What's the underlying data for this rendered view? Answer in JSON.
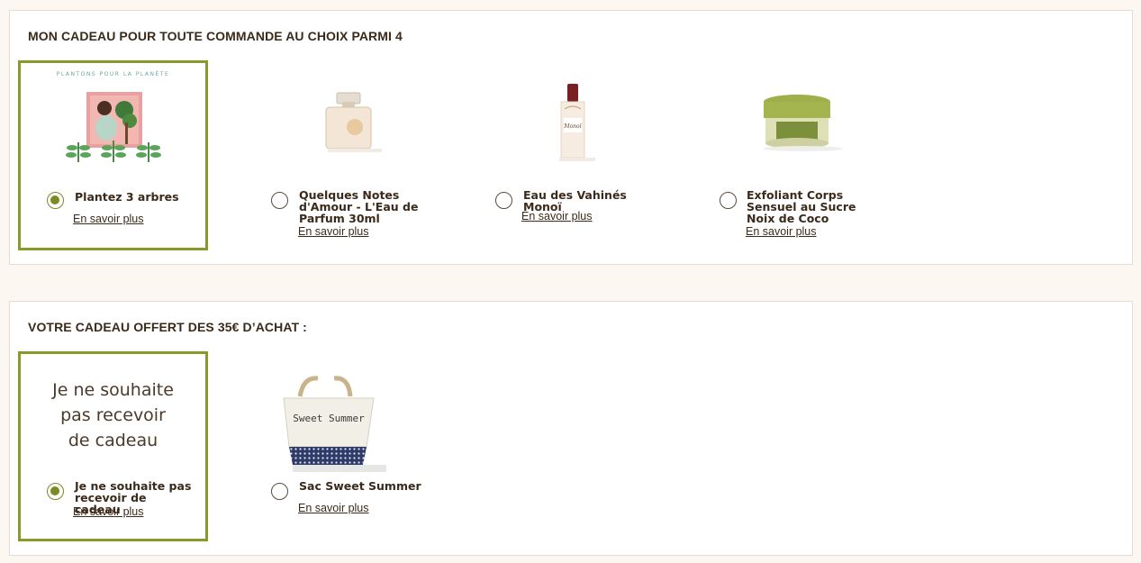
{
  "section1": {
    "title": "MON CADEAU POUR TOUTE COMMANDE AU CHOIX PARMI 4",
    "options": [
      {
        "label": "Plantez 3 arbres",
        "link": "En savoir plus",
        "caption": "PLANTONS POUR LA PLANÈTE",
        "selected": true,
        "icon": "plant-trees-image"
      },
      {
        "label": "Quelques Notes d'Amour - L'Eau de Parfum 30ml",
        "link": "En savoir plus",
        "selected": false,
        "icon": "perfume-bottle-image"
      },
      {
        "label": "Eau des Vahinés Monoï",
        "link": "En savoir plus",
        "selected": false,
        "icon": "monoi-bottle-image"
      },
      {
        "label": "Exfoliant Corps Sensuel au Sucre Noix de Coco",
        "link": "En savoir plus",
        "selected": false,
        "icon": "scrub-jar-image"
      }
    ]
  },
  "section2": {
    "title": "VOTRE CADEAU OFFERT DES 35€ D’ACHAT :",
    "options": [
      {
        "label": "Je ne souhaite pas recevoir de cadeau",
        "link": "En savoir plus",
        "card_text": "Je ne souhaite pas recevoir de cadeau",
        "selected": true,
        "icon": "no-gift-card"
      },
      {
        "label": "Sac Sweet Summer",
        "link": "En savoir plus",
        "bag_text": "Sweet Summer",
        "selected": false,
        "icon": "tote-bag-image"
      }
    ]
  },
  "colors": {
    "accent": "#8a9a2a",
    "text": "#3b2a1a",
    "background": "#fcf7f0",
    "panel": "#ffffff"
  }
}
